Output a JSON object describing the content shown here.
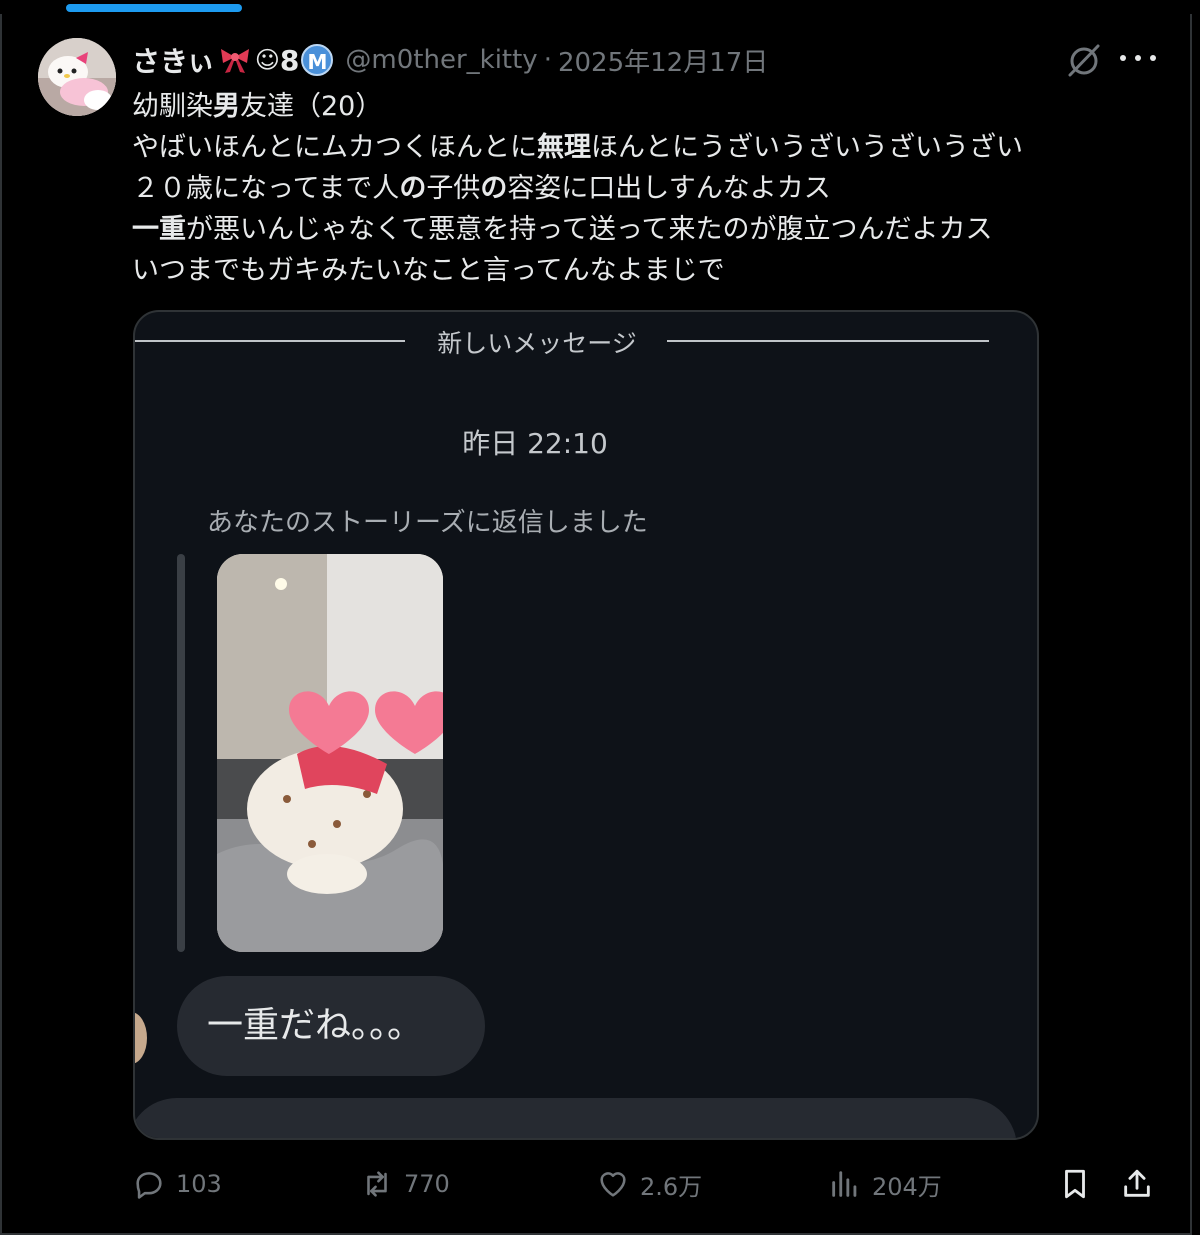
{
  "tweet": {
    "display_name": "さきぃ",
    "name_emoji_1": "☺",
    "name_number": "8",
    "badge_letter": "M",
    "handle": "@m0ther_kitty",
    "separator": "·",
    "date": "2025年12月17日",
    "text_lines": [
      [
        "幼馴染",
        "男",
        "友達（20）"
      ],
      [
        "やばいほんとにムカつくほんとに",
        "無理",
        "ほんとにうざいうざいうざいうざい"
      ],
      [
        "２０歳になってまで人",
        "の",
        "子供",
        "の",
        "容姿に口出しすんなよカス"
      ],
      [
        "一重",
        "が悪いんじゃなくて悪意を持って送って来たのが腹立つんだよカス"
      ],
      [
        "いつまでもガキみたいなこと言ってんなよまじで"
      ]
    ]
  },
  "embedded": {
    "new_messages_label": "新しいメッセージ",
    "timestamp": "昨日 22:10",
    "story_reply_text": "あなたのストーリーズに返信しました",
    "message_text": "一重だね。。。"
  },
  "actions": {
    "replies": "103",
    "reposts": "770",
    "likes": "2.6万",
    "views": "204万"
  },
  "icons": {
    "reply": "reply-icon",
    "repost": "repost-icon",
    "like": "like-icon",
    "views": "views-icon",
    "bookmark": "bookmark-icon",
    "share": "share-icon",
    "grok": "grok-icon",
    "more": "more-icon"
  },
  "colors": {
    "background": "#000000",
    "accent": "#1d9bf0",
    "muted": "#71767b",
    "text": "#e7e9ea"
  }
}
